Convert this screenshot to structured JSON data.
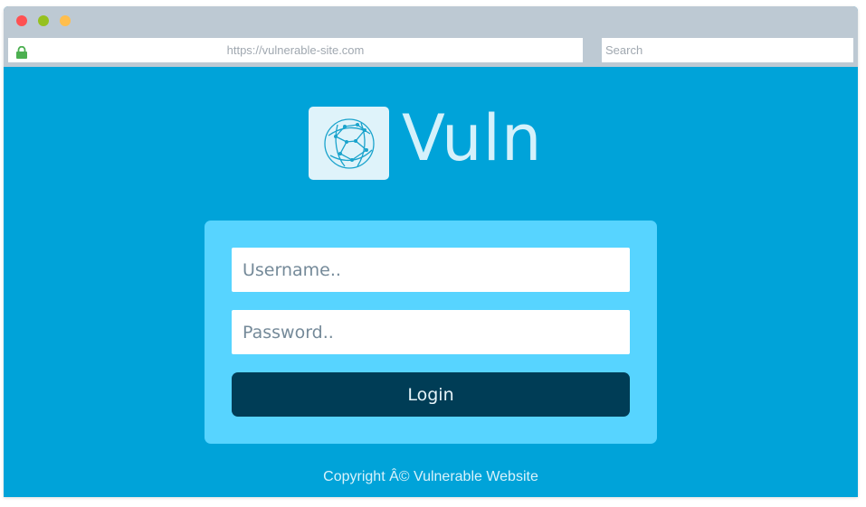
{
  "browser": {
    "url": "https://vulnerable-site.com",
    "search_placeholder": "Search",
    "icons": {
      "close": "close-dot-icon",
      "minimize": "minimize-dot-icon",
      "maximize": "maximize-dot-icon",
      "secure": "lock-icon"
    }
  },
  "logo": {
    "text": "Vuln",
    "mark_icon": "network-globe-icon"
  },
  "login_form": {
    "username_placeholder": "Username..",
    "password_placeholder": "Password..",
    "login_label": "Login"
  },
  "footer": {
    "copyright": "Copyright Â© Vulnerable Website"
  },
  "colors": {
    "page_background": "#00a3d9",
    "browser_chrome": "#bdc9d3",
    "card_background": "#57d4ff",
    "button_background": "#003d56",
    "traffic_red": "#ff5152",
    "traffic_green": "#95c11f",
    "traffic_yellow": "#ffbe4d",
    "lock_green": "#4caf50"
  }
}
